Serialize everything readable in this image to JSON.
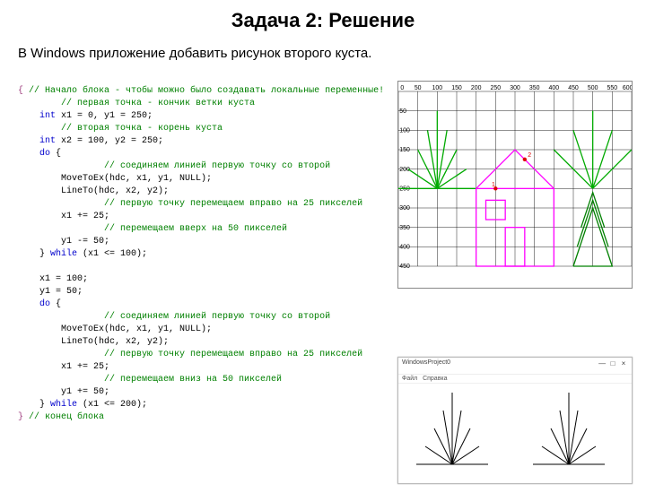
{
  "title": "Задача 2: Решение",
  "subtitle": "В Windows приложение добавить рисунок второго куста.",
  "code": {
    "l1": "{ // Начало блока - чтобы можно было создавать локальные переменные!",
    "l2": "    // первая точка - кончик ветки куста",
    "l3a": "    int",
    "l3b": " x1 = 0, y1 = 250;",
    "l4": "    // вторая точка - корень куста",
    "l5a": "    int",
    "l5b": " x2 = 100, y2 = 250;",
    "l6a": "    do",
    "l6b": " {",
    "l7": "        // соединяем линией первую точку со второй",
    "l8": "        MoveToEx(hdc, x1, y1, NULL);",
    "l9": "        LineTo(hdc, x2, y2);",
    "l10": "        // первую точку перемещаем вправо на 25 пикселей",
    "l11": "        x1 += 25;",
    "l12": "        // перемещаем вверх на 50 пикселей",
    "l13": "        y1 -= 50;",
    "l14a": "    } ",
    "l14b": "while",
    "l14c": " (x1 <= 100);",
    "l15": "",
    "l16": "    x1 = 100;",
    "l17": "    y1 = 50;",
    "l18a": "    do",
    "l18b": " {",
    "l19": "        // соединяем линией первую точку со второй",
    "l20": "        MoveToEx(hdc, x1, y1, NULL);",
    "l21": "        LineTo(hdc, x2, y2);",
    "l22": "        // первую точку перемещаем вправо на 25 пикселей",
    "l23": "        x1 += 25;",
    "l24": "        // перемещаем вниз на 50 пикселей",
    "l25": "        y1 += 50;",
    "l26a": "    } ",
    "l26b": "while",
    "l26c": " (x1 <= 200);",
    "l27": "} // конец блока"
  },
  "axis_labels": [
    "0",
    "50",
    "100",
    "150",
    "200",
    "250",
    "300",
    "350",
    "400",
    "450",
    "500",
    "550",
    "600"
  ],
  "axis_rows": [
    "50",
    "100",
    "150",
    "200",
    "250",
    "300",
    "350",
    "400",
    "450"
  ],
  "window": {
    "title": "WindowsProject0",
    "menu1": "Файл",
    "menu2": "Справка"
  }
}
